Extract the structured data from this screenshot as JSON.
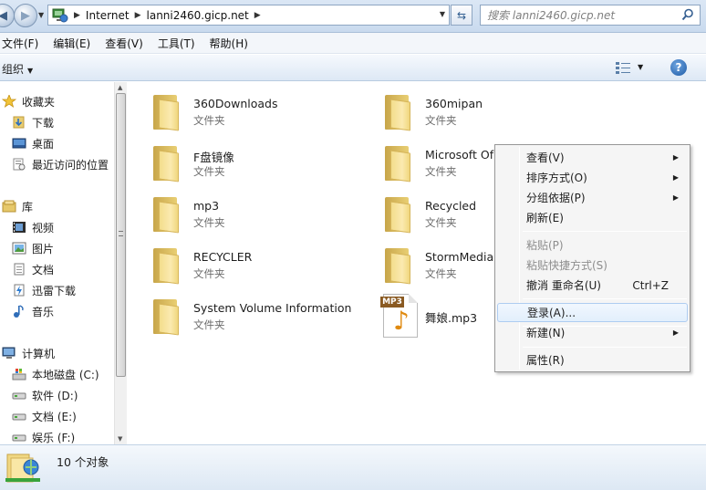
{
  "address": {
    "crumbs": [
      "Internet",
      "lanni2460.gicp.net"
    ],
    "search_placeholder": "搜索 lanni2460.gicp.net"
  },
  "menubar": [
    "文件(F)",
    "编辑(E)",
    "查看(V)",
    "工具(T)",
    "帮助(H)"
  ],
  "toolbar": {
    "organize_label": "组织"
  },
  "navpane": {
    "favorites": {
      "label": "收藏夹",
      "items": [
        "下载",
        "桌面",
        "最近访问的位置"
      ]
    },
    "libraries": {
      "label": "库",
      "items": [
        "视频",
        "图片",
        "文档",
        "迅雷下载",
        "音乐"
      ]
    },
    "computer": {
      "label": "计算机",
      "items": [
        "本地磁盘 (C:)",
        "软件 (D:)",
        "文档 (E:)",
        "娱乐 (F:)"
      ]
    }
  },
  "files": [
    {
      "name": "360Downloads",
      "type": "文件夹",
      "icon": "folder-icon"
    },
    {
      "name": "360mipan",
      "type": "文件夹",
      "icon": "folder-icon"
    },
    {
      "name": "F盘镜像",
      "type": "文件夹",
      "icon": "folder-icon"
    },
    {
      "name": "Microsoft Of",
      "type": "文件夹",
      "icon": "folder-icon"
    },
    {
      "name": "mp3",
      "type": "文件夹",
      "icon": "folder-icon"
    },
    {
      "name": "Recycled",
      "type": "文件夹",
      "icon": "folder-icon"
    },
    {
      "name": "RECYCLER",
      "type": "文件夹",
      "icon": "folder-icon"
    },
    {
      "name": "StormMedia",
      "type": "文件夹",
      "icon": "folder-icon"
    },
    {
      "name": "System Volume Information",
      "type": "文件夹",
      "icon": "folder-icon"
    },
    {
      "name": "舞娘.mp3",
      "type": "",
      "icon": "mp3-file-icon",
      "badge": "MP3"
    }
  ],
  "context_menu": {
    "view": "查看(V)",
    "sort": "排序方式(O)",
    "group": "分组依据(P)",
    "refresh": "刷新(E)",
    "paste": "粘贴(P)",
    "paste_shortcut": "粘贴快捷方式(S)",
    "undo": "撤消 重命名(U)",
    "undo_key": "Ctrl+Z",
    "login": "登录(A)...",
    "new": "新建(N)",
    "properties": "属性(R)"
  },
  "status": {
    "text": "10 个对象"
  }
}
